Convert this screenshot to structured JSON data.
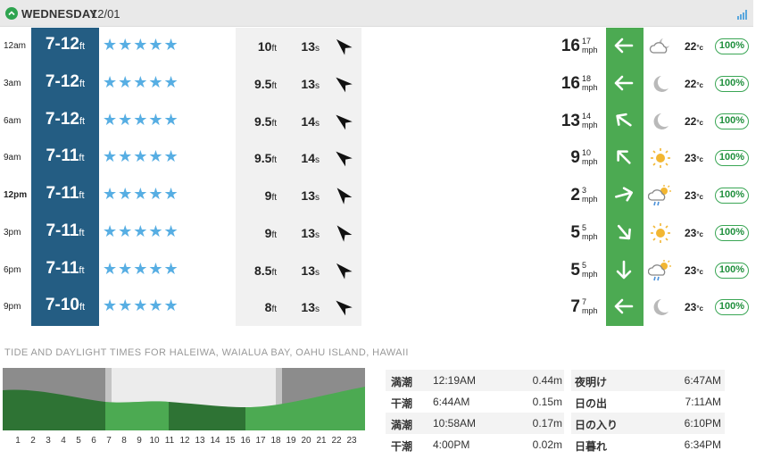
{
  "header": {
    "day": "WEDNESDAY",
    "date": "12/01",
    "chevron_icon": "chevron-up-icon",
    "signal_icon": "signal-bars-icon"
  },
  "rows": [
    {
      "time": "12am",
      "bold": false,
      "wave": "7-12",
      "wave_unit": "ft",
      "stars": "★★★★★",
      "swell_height": "10",
      "swell_height_unit": "ft",
      "swell_period": "13",
      "swell_period_unit": "s",
      "swell_dir_deg": 135,
      "wind_speed": "16",
      "wind_gust": "17",
      "wind_unit": "mph",
      "wind_dir_deg": 270,
      "weather": "cloud-moon",
      "temp": "22",
      "temp_unit": "°c",
      "prob": "100%"
    },
    {
      "time": "3am",
      "bold": false,
      "wave": "7-12",
      "wave_unit": "ft",
      "stars": "★★★★★",
      "swell_height": "9.5",
      "swell_height_unit": "ft",
      "swell_period": "13",
      "swell_period_unit": "s",
      "swell_dir_deg": 130,
      "wind_speed": "16",
      "wind_gust": "18",
      "wind_unit": "mph",
      "wind_dir_deg": 270,
      "weather": "moon",
      "temp": "22",
      "temp_unit": "°c",
      "prob": "100%"
    },
    {
      "time": "6am",
      "bold": false,
      "wave": "7-12",
      "wave_unit": "ft",
      "stars": "★★★★★",
      "swell_height": "9.5",
      "swell_height_unit": "ft",
      "swell_period": "14",
      "swell_period_unit": "s",
      "swell_dir_deg": 130,
      "wind_speed": "13",
      "wind_gust": "14",
      "wind_unit": "mph",
      "wind_dir_deg": 305,
      "weather": "moon",
      "temp": "22",
      "temp_unit": "°c",
      "prob": "100%"
    },
    {
      "time": "9am",
      "bold": false,
      "wave": "7-11",
      "wave_unit": "ft",
      "stars": "★★★★★",
      "swell_height": "9.5",
      "swell_height_unit": "ft",
      "swell_period": "14",
      "swell_period_unit": "s",
      "swell_dir_deg": 130,
      "wind_speed": "9",
      "wind_gust": "10",
      "wind_unit": "mph",
      "wind_dir_deg": 315,
      "weather": "sun",
      "temp": "23",
      "temp_unit": "°c",
      "prob": "100%"
    },
    {
      "time": "12pm",
      "bold": true,
      "wave": "7-11",
      "wave_unit": "ft",
      "stars": "★★★★★",
      "swell_height": "9",
      "swell_height_unit": "ft",
      "swell_period": "13",
      "swell_period_unit": "s",
      "swell_dir_deg": 140,
      "wind_speed": "2",
      "wind_gust": "3",
      "wind_unit": "mph",
      "wind_dir_deg": 75,
      "weather": "sun-rain",
      "temp": "23",
      "temp_unit": "°c",
      "prob": "100%"
    },
    {
      "time": "3pm",
      "bold": false,
      "wave": "7-11",
      "wave_unit": "ft",
      "stars": "★★★★★",
      "swell_height": "9",
      "swell_height_unit": "ft",
      "swell_period": "13",
      "swell_period_unit": "s",
      "swell_dir_deg": 140,
      "wind_speed": "5",
      "wind_gust": "5",
      "wind_unit": "mph",
      "wind_dir_deg": 140,
      "weather": "sun",
      "temp": "23",
      "temp_unit": "°c",
      "prob": "100%"
    },
    {
      "time": "6pm",
      "bold": false,
      "wave": "7-11",
      "wave_unit": "ft",
      "stars": "★★★★★",
      "swell_height": "8.5",
      "swell_height_unit": "ft",
      "swell_period": "13",
      "swell_period_unit": "s",
      "swell_dir_deg": 135,
      "wind_speed": "5",
      "wind_gust": "5",
      "wind_unit": "mph",
      "wind_dir_deg": 180,
      "weather": "sun-rain",
      "temp": "23",
      "temp_unit": "°c",
      "prob": "100%"
    },
    {
      "time": "9pm",
      "bold": false,
      "wave": "7-10",
      "wave_unit": "ft",
      "stars": "★★★★★",
      "swell_height": "8",
      "swell_height_unit": "ft",
      "swell_period": "13",
      "swell_period_unit": "s",
      "swell_dir_deg": 130,
      "wind_speed": "7",
      "wind_gust": "7",
      "wind_unit": "mph",
      "wind_dir_deg": 270,
      "weather": "moon",
      "temp": "23",
      "temp_unit": "°c",
      "prob": "100%"
    }
  ],
  "tide_section": {
    "title": "TIDE AND DAYLIGHT TIMES FOR HALEIWA, WAIALUA BAY, OAHU ISLAND, HAWAII",
    "hours": [
      "1",
      "2",
      "3",
      "4",
      "5",
      "6",
      "7",
      "8",
      "9",
      "10",
      "11",
      "12",
      "13",
      "14",
      "15",
      "16",
      "17",
      "18",
      "19",
      "20",
      "21",
      "22",
      "23"
    ],
    "tides": [
      {
        "label": "満潮",
        "time": "12:19AM",
        "height": "0.44m"
      },
      {
        "label": "干潮",
        "time": "6:44AM",
        "height": "0.15m"
      },
      {
        "label": "満潮",
        "time": "10:58AM",
        "height": "0.17m"
      },
      {
        "label": "干潮",
        "time": "4:00PM",
        "height": "0.02m"
      }
    ],
    "daylight": [
      {
        "label": "夜明け",
        "time": "6:47AM"
      },
      {
        "label": "日の出",
        "time": "7:11AM"
      },
      {
        "label": "日の入り",
        "time": "6:10PM"
      },
      {
        "label": "日暮れ",
        "time": "6:34PM"
      }
    ]
  },
  "colors": {
    "wave_col": "#245d83",
    "wind_col": "#4caa52",
    "star": "#57aee3",
    "tide_green": "#4caa52",
    "tide_dark": "#2e7334",
    "night": "#8c8c8c",
    "twilight": "#c4c4c4",
    "day": "#ececec"
  }
}
